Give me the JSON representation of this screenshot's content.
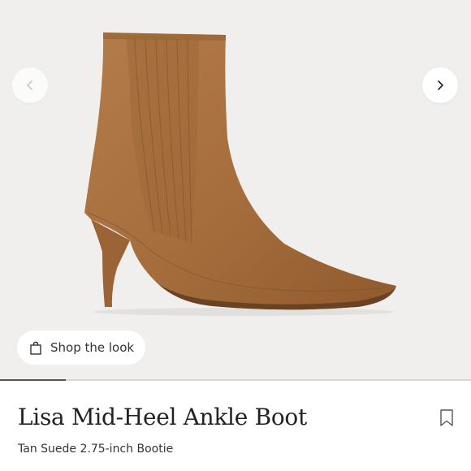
{
  "gallery": {
    "image_description_icon": "tan-suede-ankle-boot-image",
    "previous_icon": "chevron-left-icon",
    "next_icon": "chevron-right-icon",
    "progress": 0.14
  },
  "shop_look": {
    "icon": "shopping-bag-icon",
    "label": "Shop the look"
  },
  "product": {
    "title": "Lisa Mid-Heel Ankle Boot",
    "subtitle": "Tan Suede 2.75-inch Bootie",
    "save_icon": "bookmark-icon"
  },
  "colors": {
    "background": "#f0efed",
    "suede": "#a8703f",
    "text": "#222222"
  }
}
